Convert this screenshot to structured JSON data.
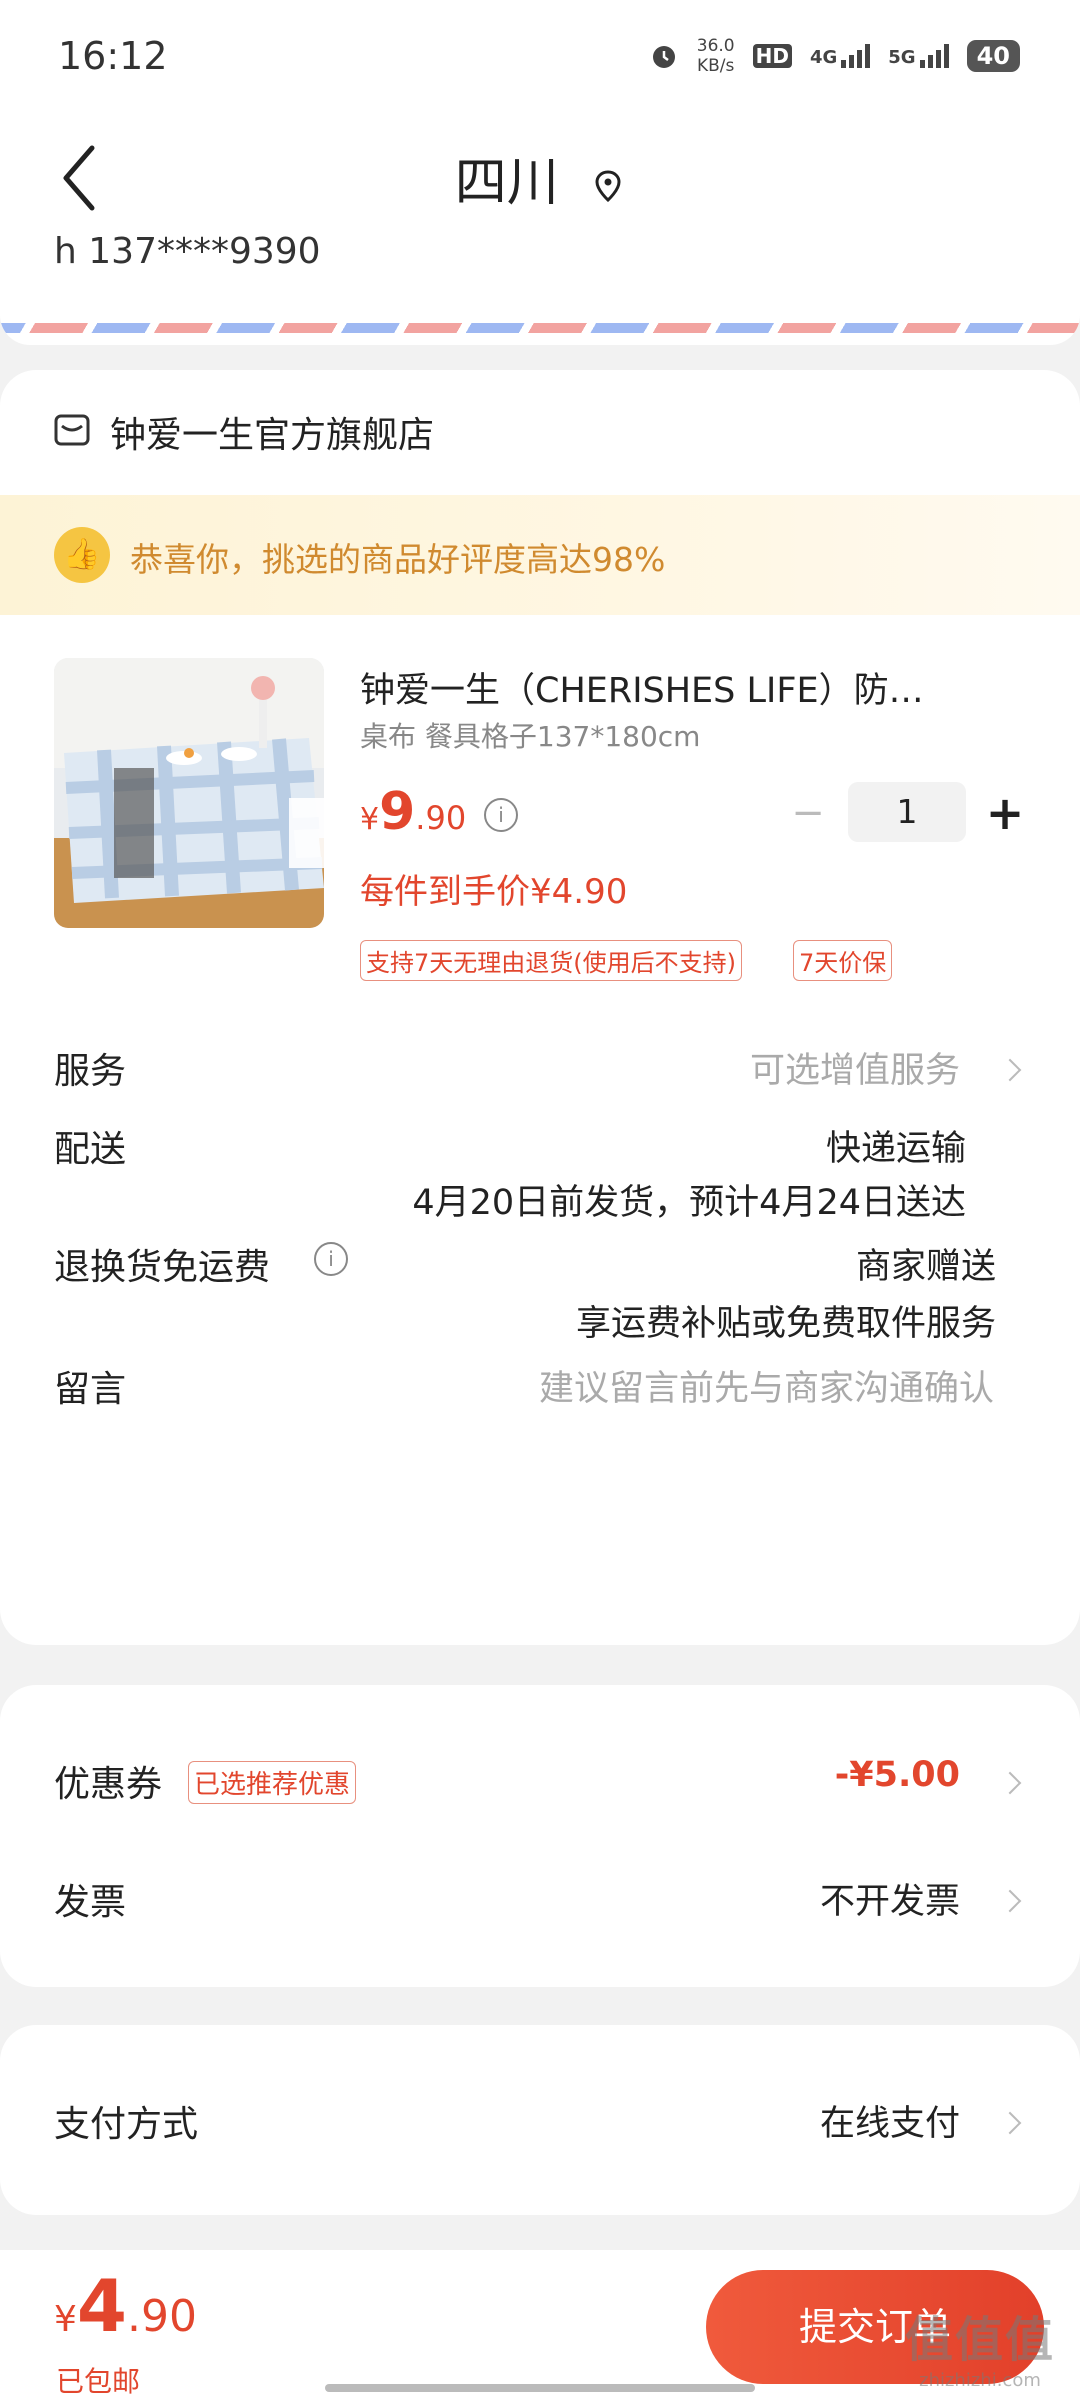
{
  "status_bar": {
    "time": "16:12",
    "net_speed_value": "36.0",
    "net_speed_unit": "KB/s",
    "hd_label": "HD",
    "net1": "4G",
    "net2": "5G",
    "battery": "40"
  },
  "header": {
    "title": "四川",
    "back_icon": "chevron-left-icon",
    "location_icon": "location-pin-icon"
  },
  "address": {
    "phone": "h  137****9390"
  },
  "store": {
    "name": "钟爱一生官方旗舰店",
    "praise_text": "恭喜你，挑选的商品好评度高达98%"
  },
  "product": {
    "title": "钟爱一生（CHERISHES LIFE）防…",
    "spec": "桌布 餐具格子137*180cm",
    "price_currency": "¥",
    "price_int": "9",
    "price_dec": ".90",
    "quantity": "1",
    "minus": "−",
    "plus": "+",
    "each_price": "每件到手价¥4.90",
    "tags": [
      "支持7天无理由退货(使用后不支持)",
      "7天价保"
    ]
  },
  "rows": {
    "service_label": "服务",
    "service_value": "可选增值服务",
    "delivery_label": "配送",
    "delivery_method": "快递运输",
    "delivery_time": "4月20日前发货，预计4月24日送达",
    "return_label": "退换货免运费",
    "return_value1": "商家赠送",
    "return_value2": "享运费补贴或免费取件服务",
    "message_label": "留言",
    "message_placeholder": "建议留言前先与商家沟通确认"
  },
  "coupon": {
    "label": "优惠券",
    "badge": "已选推荐优惠",
    "value": "-¥5.00",
    "invoice_label": "发票",
    "invoice_value": "不开发票"
  },
  "payment": {
    "label": "支付方式",
    "value": "在线支付"
  },
  "bottom": {
    "currency": "¥",
    "total_int": "4",
    "total_dec": ".90",
    "free_shipping": "已包邮",
    "submit": "提交订单"
  },
  "watermark": {
    "main": "值值值",
    "sub": "zhizhizhi.com"
  },
  "colors": {
    "accent": "#e2462d",
    "praise": "#d08a2f"
  }
}
